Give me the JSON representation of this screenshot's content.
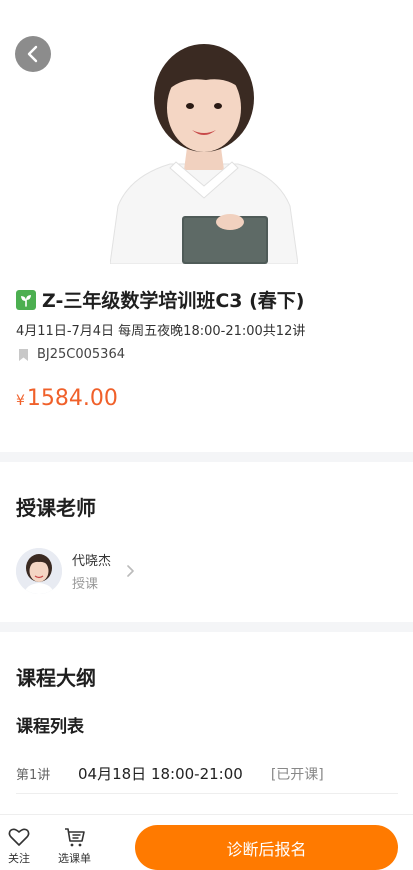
{
  "header": {
    "back_icon": "chevron-left-icon"
  },
  "course": {
    "title": "Z-三年级数学培训班C3 (春下)",
    "title_icon": "sprout-icon",
    "schedule": "4月11日-7月4日  每周五夜晚18:00-21:00共12讲",
    "code": "BJ25C005364",
    "price_symbol": "¥",
    "price": "1584.00"
  },
  "teacher_section": {
    "title": "授课老师",
    "teacher": {
      "name": "代晓杰",
      "role": "授课"
    }
  },
  "outline_section": {
    "title": "课程大纲",
    "list_title": "课程列表",
    "lessons": [
      {
        "number": "第1讲",
        "time": "04月18日 18:00-21:00",
        "status": "[已开课]"
      }
    ]
  },
  "bottom_bar": {
    "follow_label": "关注",
    "cart_label": "选课单",
    "cta_label": "诊断后报名"
  },
  "colors": {
    "accent": "#ff7a00",
    "price": "#f0602a",
    "sprout": "#4caf50"
  }
}
